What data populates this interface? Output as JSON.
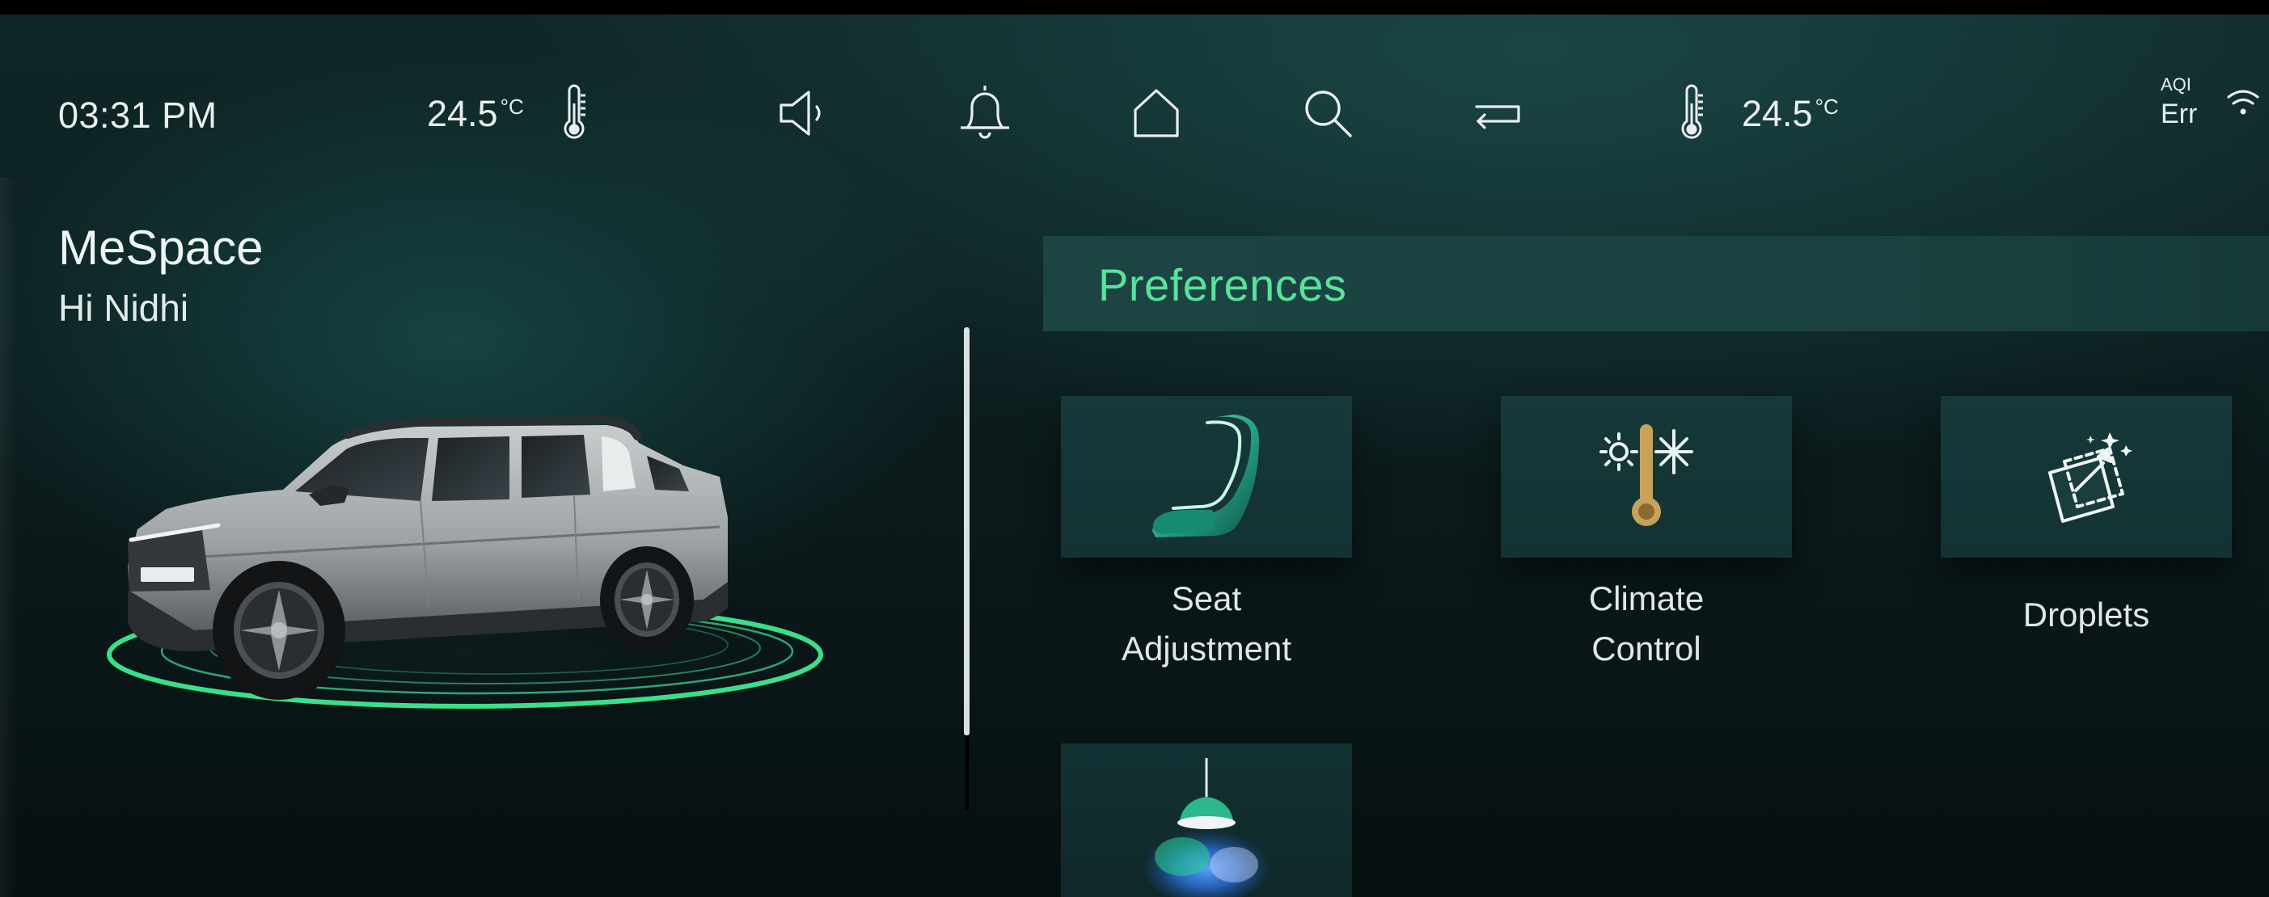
{
  "status_bar": {
    "time": "03:31 PM",
    "left_temp": {
      "value": "24.5",
      "unit": "°C"
    },
    "right_temp": {
      "value": "24.5",
      "unit": "°C"
    },
    "aqi": {
      "label": "AQI",
      "value": "Err"
    },
    "nav_icons": [
      "volume-icon",
      "bell-icon",
      "home-icon",
      "search-icon",
      "back-icon"
    ]
  },
  "profile": {
    "app_name": "MeSpace",
    "greeting": "Hi Nidhi"
  },
  "preferences": {
    "title": "Preferences",
    "cards": [
      {
        "icon": "seat-icon",
        "line1": "Seat",
        "line2": "Adjustment"
      },
      {
        "icon": "climate-icon",
        "line1": "Climate",
        "line2": "Control"
      },
      {
        "icon": "droplets-icon",
        "line1": "Droplets",
        "line2": ""
      },
      {
        "icon": "ambient-lamp-icon",
        "line1": "",
        "line2": ""
      }
    ]
  },
  "colors": {
    "accent_green": "#58e29c",
    "ring_green": "#39e08a",
    "background": "#0c1d1e",
    "header_bg": "#1b4442"
  }
}
